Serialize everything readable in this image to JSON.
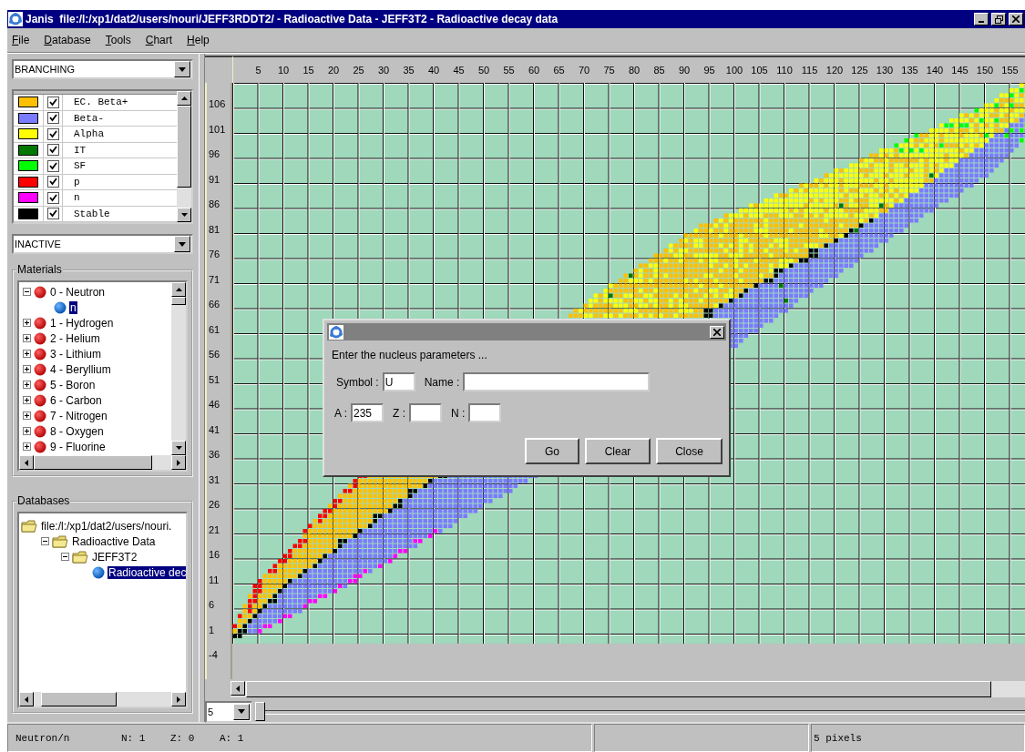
{
  "window": {
    "title": "Janis  file:/l:/xp1/dat2/users/nouri/JEFF3RDDT2/ - Radioactive Data - JEFF3T2 - Radioactive decay data"
  },
  "menu": [
    "File",
    "Database",
    "Tools",
    "Chart",
    "Help"
  ],
  "left_panel": {
    "mode_combo": "BRANCHING",
    "legend": [
      {
        "label": "EC. Beta+",
        "color": "#ffc000",
        "checked": true
      },
      {
        "label": "Beta-",
        "color": "#7b7bff",
        "checked": true
      },
      {
        "label": "Alpha",
        "color": "#ffff00",
        "checked": true
      },
      {
        "label": "IT",
        "color": "#007800",
        "checked": true
      },
      {
        "label": "SF",
        "color": "#00ff00",
        "checked": true
      },
      {
        "label": "p",
        "color": "#ff0000",
        "checked": true
      },
      {
        "label": "n",
        "color": "#ff00ff",
        "checked": true
      },
      {
        "label": "Stable",
        "color": "#000000",
        "checked": true
      }
    ],
    "filter_combo": "INACTIVE",
    "materials": {
      "title": "Materials",
      "tree": [
        {
          "label": "0 - Neutron",
          "kind": "element",
          "expanded": true,
          "selected": false,
          "children": [
            {
              "label": "n",
              "kind": "nuclide",
              "selected": true
            }
          ]
        },
        {
          "label": "1 - Hydrogen",
          "kind": "element",
          "expanded": false,
          "selected": false
        },
        {
          "label": "2 - Helium",
          "kind": "element",
          "expanded": false,
          "selected": false
        },
        {
          "label": "3 - Lithium",
          "kind": "element",
          "expanded": false,
          "selected": false
        },
        {
          "label": "4 - Beryllium",
          "kind": "element",
          "expanded": false,
          "selected": false
        },
        {
          "label": "5 - Boron",
          "kind": "element",
          "expanded": false,
          "selected": false
        },
        {
          "label": "6 - Carbon",
          "kind": "element",
          "expanded": false,
          "selected": false
        },
        {
          "label": "7 - Nitrogen",
          "kind": "element",
          "expanded": false,
          "selected": false
        },
        {
          "label": "8 - Oxygen",
          "kind": "element",
          "expanded": false,
          "selected": false
        },
        {
          "label": "9 - Fluorine",
          "kind": "element",
          "expanded": false,
          "selected": false
        }
      ]
    },
    "databases": {
      "title": "Databases",
      "tree": [
        {
          "label": "file:/l:/xp1/dat2/users/nouri.",
          "kind": "folder",
          "selected": false,
          "children": [
            {
              "label": "Radioactive Data",
              "kind": "folder",
              "expanded": true,
              "selected": false,
              "children": [
                {
                  "label": "JEFF3T2",
                  "kind": "folder",
                  "expanded": true,
                  "selected": false,
                  "children": [
                    {
                      "label": "Radioactive dec",
                      "kind": "nuclide",
                      "selected": true
                    }
                  ]
                }
              ]
            }
          ]
        }
      ]
    }
  },
  "chart": {
    "x_ticks": [
      "5",
      "10",
      "15",
      "20",
      "25",
      "30",
      "35",
      "40",
      "45",
      "50",
      "55",
      "60",
      "65",
      "70",
      "75",
      "80",
      "85",
      "90",
      "95",
      "100",
      "105",
      "110",
      "115",
      "120",
      "125",
      "130",
      "135",
      "140",
      "145",
      "150",
      "155"
    ],
    "y_ticks": [
      "106",
      "101",
      "96",
      "91",
      "86",
      "81",
      "76",
      "71",
      "66",
      "61",
      "56",
      "51",
      "46",
      "41",
      "36",
      "31",
      "26",
      "21",
      "16",
      "11",
      "6",
      "1",
      "-4"
    ]
  },
  "dialog": {
    "prompt": "Enter the nucleus parameters ...",
    "rows": [
      [
        {
          "label": "Symbol :",
          "value": "U",
          "kind": "narrow"
        },
        {
          "label": "Name :",
          "kind": "wide"
        }
      ],
      [
        {
          "label": "A :",
          "value": "235",
          "kind": "narrow"
        },
        {
          "label": "Z :",
          "kind": "narrow"
        },
        {
          "label": "N :",
          "kind": "narrow"
        }
      ]
    ],
    "buttons": [
      "Go",
      "Clear",
      "Close"
    ]
  },
  "zoom_combo": "5",
  "zoom_slider": {
    "level": 0
  },
  "status_bar": {
    "nuclide": "Neutron/n",
    "n": "N: 1",
    "z": "Z: 0",
    "a": "A: 1",
    "scale": "5 pixels"
  }
}
